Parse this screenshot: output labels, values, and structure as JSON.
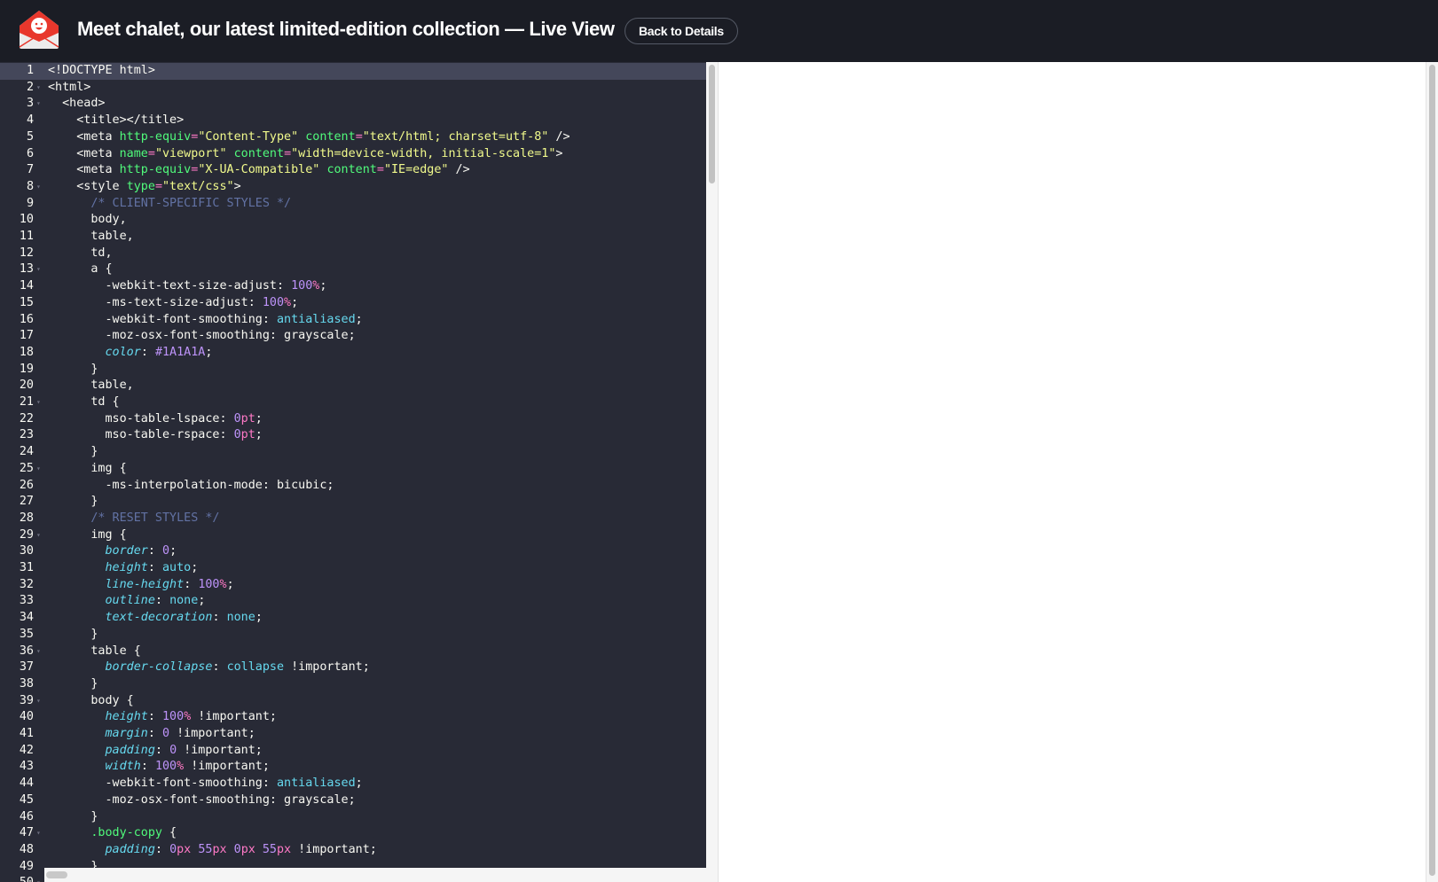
{
  "header": {
    "title": "Meet chalet, our latest limited-edition collection — Live View",
    "back_label": "Back to Details",
    "logo_icon": "envelope-smiley-logo",
    "bg_color": "#1b1d25"
  },
  "editor": {
    "theme_bg": "#282a36",
    "active_line": 1,
    "fold_lines": [
      2,
      3,
      8,
      13,
      21,
      25,
      29,
      36,
      39,
      47,
      50
    ],
    "lines": [
      [
        [
          "tag",
          "<!DOCTYPE html>"
        ]
      ],
      [
        [
          "tag",
          "<html>"
        ]
      ],
      [
        [
          "tag",
          "  <head>"
        ]
      ],
      [
        [
          "tag",
          "    <title></title>"
        ]
      ],
      [
        [
          "tag",
          "    <meta "
        ],
        [
          "attr",
          "http-equiv"
        ],
        [
          "eq",
          "="
        ],
        [
          "str",
          "\"Content-Type\""
        ],
        [
          "tag",
          " "
        ],
        [
          "attr",
          "content"
        ],
        [
          "eq",
          "="
        ],
        [
          "str",
          "\"text/html; charset=utf-8\""
        ],
        [
          "tag",
          " />"
        ]
      ],
      [
        [
          "tag",
          "    <meta "
        ],
        [
          "attr",
          "name"
        ],
        [
          "eq",
          "="
        ],
        [
          "str",
          "\"viewport\""
        ],
        [
          "tag",
          " "
        ],
        [
          "attr",
          "content"
        ],
        [
          "eq",
          "="
        ],
        [
          "str",
          "\"width=device-width, initial-scale=1\""
        ],
        [
          "tag",
          ">"
        ]
      ],
      [
        [
          "tag",
          "    <meta "
        ],
        [
          "attr",
          "http-equiv"
        ],
        [
          "eq",
          "="
        ],
        [
          "str",
          "\"X-UA-Compatible\""
        ],
        [
          "tag",
          " "
        ],
        [
          "attr",
          "content"
        ],
        [
          "eq",
          "="
        ],
        [
          "str",
          "\"IE=edge\""
        ],
        [
          "tag",
          " />"
        ]
      ],
      [
        [
          "tag",
          "    <style "
        ],
        [
          "attr",
          "type"
        ],
        [
          "eq",
          "="
        ],
        [
          "str",
          "\"text/css\""
        ],
        [
          "tag",
          ">"
        ]
      ],
      [
        [
          "tag",
          "      "
        ],
        [
          "cmt",
          "/* CLIENT-SPECIFIC STYLES */"
        ]
      ],
      [
        [
          "tag",
          "      body,"
        ]
      ],
      [
        [
          "tag",
          "      table,"
        ]
      ],
      [
        [
          "tag",
          "      td,"
        ]
      ],
      [
        [
          "tag",
          "      a {"
        ]
      ],
      [
        [
          "tag",
          "        -webkit-text-size-adjust: "
        ],
        [
          "num",
          "100"
        ],
        [
          "unit",
          "%"
        ],
        [
          "tag",
          ";"
        ]
      ],
      [
        [
          "tag",
          "        -ms-text-size-adjust: "
        ],
        [
          "num",
          "100"
        ],
        [
          "unit",
          "%"
        ],
        [
          "tag",
          ";"
        ]
      ],
      [
        [
          "tag",
          "        -webkit-font-smoothing: "
        ],
        [
          "val",
          "antialiased"
        ],
        [
          "tag",
          ";"
        ]
      ],
      [
        [
          "tag",
          "        -moz-osx-font-smoothing: grayscale;"
        ]
      ],
      [
        [
          "tag",
          "        "
        ],
        [
          "prop",
          "color"
        ],
        [
          "tag",
          ": "
        ],
        [
          "num",
          "#1A1A1A"
        ],
        [
          "tag",
          ";"
        ]
      ],
      [
        [
          "tag",
          "      }"
        ]
      ],
      [
        [
          "tag",
          "      table,"
        ]
      ],
      [
        [
          "tag",
          "      td {"
        ]
      ],
      [
        [
          "tag",
          "        mso-table-lspace: "
        ],
        [
          "num",
          "0"
        ],
        [
          "unit",
          "pt"
        ],
        [
          "tag",
          ";"
        ]
      ],
      [
        [
          "tag",
          "        mso-table-rspace: "
        ],
        [
          "num",
          "0"
        ],
        [
          "unit",
          "pt"
        ],
        [
          "tag",
          ";"
        ]
      ],
      [
        [
          "tag",
          "      }"
        ]
      ],
      [
        [
          "tag",
          "      img {"
        ]
      ],
      [
        [
          "tag",
          "        -ms-interpolation-mode: bicubic;"
        ]
      ],
      [
        [
          "tag",
          "      }"
        ]
      ],
      [
        [
          "tag",
          "      "
        ],
        [
          "cmt",
          "/* RESET STYLES */"
        ]
      ],
      [
        [
          "tag",
          "      img {"
        ]
      ],
      [
        [
          "tag",
          "        "
        ],
        [
          "prop",
          "border"
        ],
        [
          "tag",
          ": "
        ],
        [
          "num",
          "0"
        ],
        [
          "tag",
          ";"
        ]
      ],
      [
        [
          "tag",
          "        "
        ],
        [
          "prop",
          "height"
        ],
        [
          "tag",
          ": "
        ],
        [
          "val",
          "auto"
        ],
        [
          "tag",
          ";"
        ]
      ],
      [
        [
          "tag",
          "        "
        ],
        [
          "prop",
          "line-height"
        ],
        [
          "tag",
          ": "
        ],
        [
          "num",
          "100"
        ],
        [
          "unit",
          "%"
        ],
        [
          "tag",
          ";"
        ]
      ],
      [
        [
          "tag",
          "        "
        ],
        [
          "prop",
          "outline"
        ],
        [
          "tag",
          ": "
        ],
        [
          "val",
          "none"
        ],
        [
          "tag",
          ";"
        ]
      ],
      [
        [
          "tag",
          "        "
        ],
        [
          "prop",
          "text-decoration"
        ],
        [
          "tag",
          ": "
        ],
        [
          "val",
          "none"
        ],
        [
          "tag",
          ";"
        ]
      ],
      [
        [
          "tag",
          "      }"
        ]
      ],
      [
        [
          "tag",
          "      table {"
        ]
      ],
      [
        [
          "tag",
          "        "
        ],
        [
          "prop",
          "border-collapse"
        ],
        [
          "tag",
          ": "
        ],
        [
          "val",
          "collapse"
        ],
        [
          "tag",
          " !important;"
        ]
      ],
      [
        [
          "tag",
          "      }"
        ]
      ],
      [
        [
          "tag",
          "      body {"
        ]
      ],
      [
        [
          "tag",
          "        "
        ],
        [
          "prop",
          "height"
        ],
        [
          "tag",
          ": "
        ],
        [
          "num",
          "100"
        ],
        [
          "unit",
          "%"
        ],
        [
          "tag",
          " !important;"
        ]
      ],
      [
        [
          "tag",
          "        "
        ],
        [
          "prop",
          "margin"
        ],
        [
          "tag",
          ": "
        ],
        [
          "num",
          "0"
        ],
        [
          "tag",
          " !important;"
        ]
      ],
      [
        [
          "tag",
          "        "
        ],
        [
          "prop",
          "padding"
        ],
        [
          "tag",
          ": "
        ],
        [
          "num",
          "0"
        ],
        [
          "tag",
          " !important;"
        ]
      ],
      [
        [
          "tag",
          "        "
        ],
        [
          "prop",
          "width"
        ],
        [
          "tag",
          ": "
        ],
        [
          "num",
          "100"
        ],
        [
          "unit",
          "%"
        ],
        [
          "tag",
          " !important;"
        ]
      ],
      [
        [
          "tag",
          "        -webkit-font-smoothing: "
        ],
        [
          "val",
          "antialiased"
        ],
        [
          "tag",
          ";"
        ]
      ],
      [
        [
          "tag",
          "        -moz-osx-font-smoothing: grayscale;"
        ]
      ],
      [
        [
          "tag",
          "      }"
        ]
      ],
      [
        [
          "tag",
          "      "
        ],
        [
          "sel",
          ".body-copy"
        ],
        [
          "tag",
          " {"
        ]
      ],
      [
        [
          "tag",
          "        "
        ],
        [
          "prop",
          "padding"
        ],
        [
          "tag",
          ": "
        ],
        [
          "num",
          "0"
        ],
        [
          "unit",
          "px"
        ],
        [
          "tag",
          " "
        ],
        [
          "num",
          "55"
        ],
        [
          "unit",
          "px"
        ],
        [
          "tag",
          " "
        ],
        [
          "num",
          "0"
        ],
        [
          "unit",
          "px"
        ],
        [
          "tag",
          " "
        ],
        [
          "num",
          "55"
        ],
        [
          "unit",
          "px"
        ],
        [
          "tag",
          " !important;"
        ]
      ],
      [
        [
          "tag",
          "      }"
        ]
      ],
      [
        [
          "tag",
          ""
        ]
      ]
    ]
  }
}
